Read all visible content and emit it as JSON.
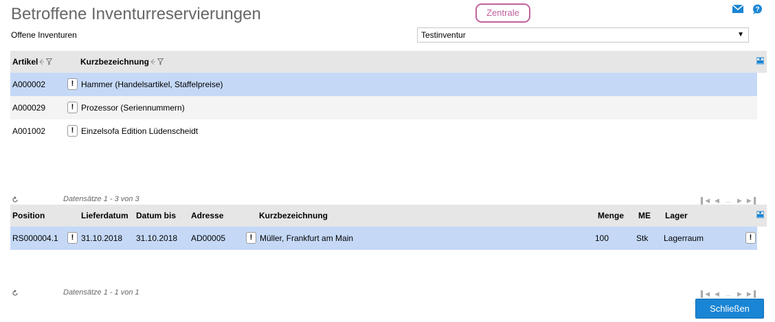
{
  "page": {
    "title": "Betroffene Inventurreservierungen",
    "zentrale": "Zentrale"
  },
  "inventory": {
    "label": "Offene Inventuren",
    "selected": "Testinventur"
  },
  "grid1": {
    "columns": [
      "Artikel",
      "Kurzbezeichnung"
    ],
    "rows": [
      {
        "artikel": "A000002",
        "kurz": "Hammer (Handelsartikel, Staffelpreise)"
      },
      {
        "artikel": "A000029",
        "kurz": "Prozessor (Seriennummern)"
      },
      {
        "artikel": "A001002",
        "kurz": "Einzelsofa Edition Lüdenscheidt"
      }
    ],
    "records": "Datensätze 1 - 3 von 3"
  },
  "grid2": {
    "columns": [
      "Position",
      "Lieferdatum",
      "Datum bis",
      "Adresse",
      "Kurzbezeichnung",
      "Menge",
      "ME",
      "Lager"
    ],
    "rows": [
      {
        "position": "RS000004.1",
        "lieferdatum": "31.10.2018",
        "datum_bis": "31.10.2018",
        "adresse": "AD00005",
        "kurz": "Müller, Frankfurt am Main",
        "menge": "100",
        "me": "Stk",
        "lager": "Lagerraum"
      }
    ],
    "records": "Datensätze 1 - 1 von 1"
  },
  "icons": {
    "info": "!",
    "mail": "mail-icon",
    "help": "help-icon",
    "refresh": "refresh-icon",
    "pager_dots": "..."
  },
  "buttons": {
    "close": "Schließen"
  },
  "colors": {
    "accent": "#1a85d4",
    "zentrale": "#c1609e",
    "selected_row": "#c5d9f7",
    "header_bg": "#e6e6e6"
  }
}
